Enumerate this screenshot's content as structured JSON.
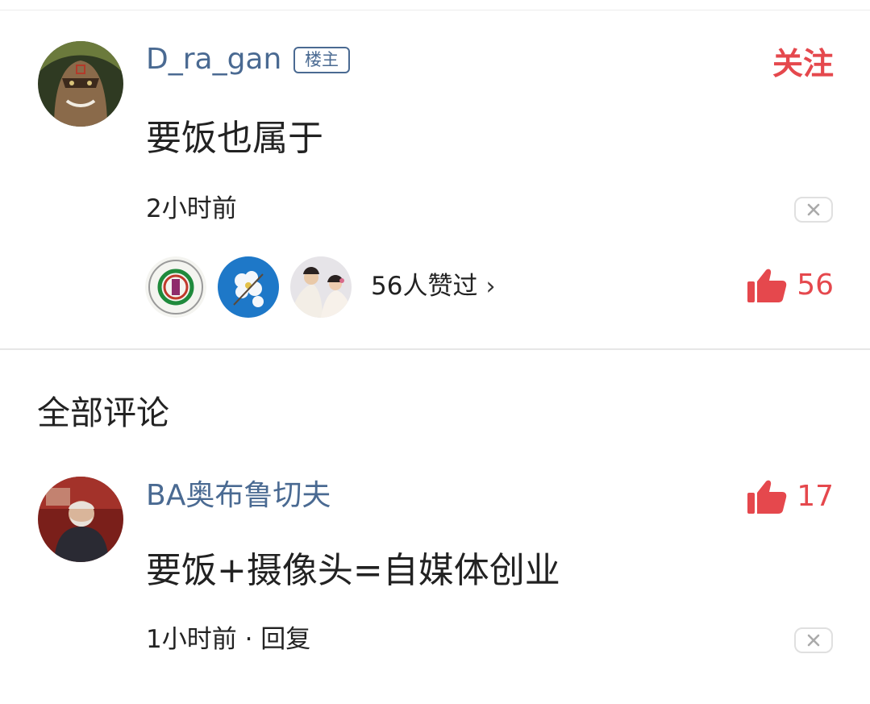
{
  "post": {
    "username": "D_ra_gan",
    "badge": "楼主",
    "follow_label": "关注",
    "content": "要饭也属于",
    "time": "2小时前",
    "likes_summary": "56人赞过",
    "like_count": "56",
    "close_icon": "close-icon"
  },
  "comments_section": {
    "title": "全部评论"
  },
  "comments": [
    {
      "username": "BA奥布鲁切夫",
      "content": "要饭+摄像头=自媒体创业",
      "time_reply": "1小时前 · 回复",
      "like_count": "17"
    }
  ],
  "colors": {
    "accent_red": "#e5484d",
    "username_blue": "#4a6a92",
    "text": "#222222"
  }
}
